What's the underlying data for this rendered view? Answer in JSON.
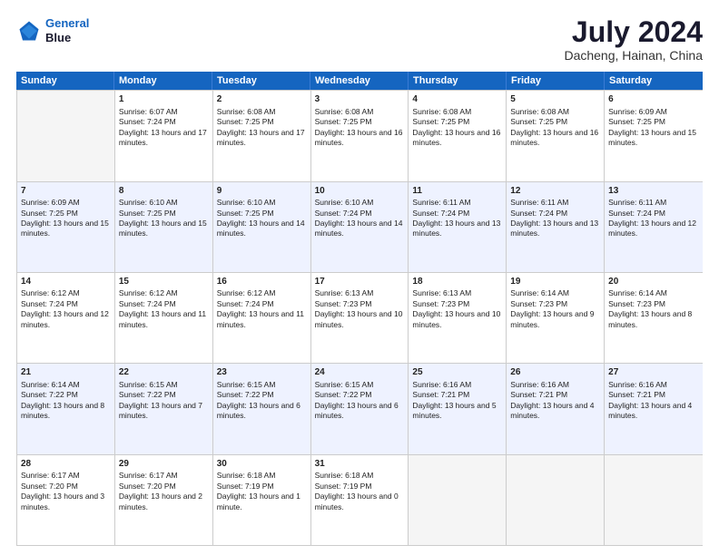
{
  "logo": {
    "line1": "General",
    "line2": "Blue"
  },
  "title": "July 2024",
  "subtitle": "Dacheng, Hainan, China",
  "header_days": [
    "Sunday",
    "Monday",
    "Tuesday",
    "Wednesday",
    "Thursday",
    "Friday",
    "Saturday"
  ],
  "weeks": [
    [
      {
        "day": "",
        "sunrise": "",
        "sunset": "",
        "daylight": "",
        "empty": true
      },
      {
        "day": "1",
        "sunrise": "Sunrise: 6:07 AM",
        "sunset": "Sunset: 7:24 PM",
        "daylight": "Daylight: 13 hours and 17 minutes."
      },
      {
        "day": "2",
        "sunrise": "Sunrise: 6:08 AM",
        "sunset": "Sunset: 7:25 PM",
        "daylight": "Daylight: 13 hours and 17 minutes."
      },
      {
        "day": "3",
        "sunrise": "Sunrise: 6:08 AM",
        "sunset": "Sunset: 7:25 PM",
        "daylight": "Daylight: 13 hours and 16 minutes."
      },
      {
        "day": "4",
        "sunrise": "Sunrise: 6:08 AM",
        "sunset": "Sunset: 7:25 PM",
        "daylight": "Daylight: 13 hours and 16 minutes."
      },
      {
        "day": "5",
        "sunrise": "Sunrise: 6:08 AM",
        "sunset": "Sunset: 7:25 PM",
        "daylight": "Daylight: 13 hours and 16 minutes."
      },
      {
        "day": "6",
        "sunrise": "Sunrise: 6:09 AM",
        "sunset": "Sunset: 7:25 PM",
        "daylight": "Daylight: 13 hours and 15 minutes."
      }
    ],
    [
      {
        "day": "7",
        "sunrise": "Sunrise: 6:09 AM",
        "sunset": "Sunset: 7:25 PM",
        "daylight": "Daylight: 13 hours and 15 minutes."
      },
      {
        "day": "8",
        "sunrise": "Sunrise: 6:10 AM",
        "sunset": "Sunset: 7:25 PM",
        "daylight": "Daylight: 13 hours and 15 minutes."
      },
      {
        "day": "9",
        "sunrise": "Sunrise: 6:10 AM",
        "sunset": "Sunset: 7:25 PM",
        "daylight": "Daylight: 13 hours and 14 minutes."
      },
      {
        "day": "10",
        "sunrise": "Sunrise: 6:10 AM",
        "sunset": "Sunset: 7:24 PM",
        "daylight": "Daylight: 13 hours and 14 minutes."
      },
      {
        "day": "11",
        "sunrise": "Sunrise: 6:11 AM",
        "sunset": "Sunset: 7:24 PM",
        "daylight": "Daylight: 13 hours and 13 minutes."
      },
      {
        "day": "12",
        "sunrise": "Sunrise: 6:11 AM",
        "sunset": "Sunset: 7:24 PM",
        "daylight": "Daylight: 13 hours and 13 minutes."
      },
      {
        "day": "13",
        "sunrise": "Sunrise: 6:11 AM",
        "sunset": "Sunset: 7:24 PM",
        "daylight": "Daylight: 13 hours and 12 minutes."
      }
    ],
    [
      {
        "day": "14",
        "sunrise": "Sunrise: 6:12 AM",
        "sunset": "Sunset: 7:24 PM",
        "daylight": "Daylight: 13 hours and 12 minutes."
      },
      {
        "day": "15",
        "sunrise": "Sunrise: 6:12 AM",
        "sunset": "Sunset: 7:24 PM",
        "daylight": "Daylight: 13 hours and 11 minutes."
      },
      {
        "day": "16",
        "sunrise": "Sunrise: 6:12 AM",
        "sunset": "Sunset: 7:24 PM",
        "daylight": "Daylight: 13 hours and 11 minutes."
      },
      {
        "day": "17",
        "sunrise": "Sunrise: 6:13 AM",
        "sunset": "Sunset: 7:23 PM",
        "daylight": "Daylight: 13 hours and 10 minutes."
      },
      {
        "day": "18",
        "sunrise": "Sunrise: 6:13 AM",
        "sunset": "Sunset: 7:23 PM",
        "daylight": "Daylight: 13 hours and 10 minutes."
      },
      {
        "day": "19",
        "sunrise": "Sunrise: 6:14 AM",
        "sunset": "Sunset: 7:23 PM",
        "daylight": "Daylight: 13 hours and 9 minutes."
      },
      {
        "day": "20",
        "sunrise": "Sunrise: 6:14 AM",
        "sunset": "Sunset: 7:23 PM",
        "daylight": "Daylight: 13 hours and 8 minutes."
      }
    ],
    [
      {
        "day": "21",
        "sunrise": "Sunrise: 6:14 AM",
        "sunset": "Sunset: 7:22 PM",
        "daylight": "Daylight: 13 hours and 8 minutes."
      },
      {
        "day": "22",
        "sunrise": "Sunrise: 6:15 AM",
        "sunset": "Sunset: 7:22 PM",
        "daylight": "Daylight: 13 hours and 7 minutes."
      },
      {
        "day": "23",
        "sunrise": "Sunrise: 6:15 AM",
        "sunset": "Sunset: 7:22 PM",
        "daylight": "Daylight: 13 hours and 6 minutes."
      },
      {
        "day": "24",
        "sunrise": "Sunrise: 6:15 AM",
        "sunset": "Sunset: 7:22 PM",
        "daylight": "Daylight: 13 hours and 6 minutes."
      },
      {
        "day": "25",
        "sunrise": "Sunrise: 6:16 AM",
        "sunset": "Sunset: 7:21 PM",
        "daylight": "Daylight: 13 hours and 5 minutes."
      },
      {
        "day": "26",
        "sunrise": "Sunrise: 6:16 AM",
        "sunset": "Sunset: 7:21 PM",
        "daylight": "Daylight: 13 hours and 4 minutes."
      },
      {
        "day": "27",
        "sunrise": "Sunrise: 6:16 AM",
        "sunset": "Sunset: 7:21 PM",
        "daylight": "Daylight: 13 hours and 4 minutes."
      }
    ],
    [
      {
        "day": "28",
        "sunrise": "Sunrise: 6:17 AM",
        "sunset": "Sunset: 7:20 PM",
        "daylight": "Daylight: 13 hours and 3 minutes."
      },
      {
        "day": "29",
        "sunrise": "Sunrise: 6:17 AM",
        "sunset": "Sunset: 7:20 PM",
        "daylight": "Daylight: 13 hours and 2 minutes."
      },
      {
        "day": "30",
        "sunrise": "Sunrise: 6:18 AM",
        "sunset": "Sunset: 7:19 PM",
        "daylight": "Daylight: 13 hours and 1 minute."
      },
      {
        "day": "31",
        "sunrise": "Sunrise: 6:18 AM",
        "sunset": "Sunset: 7:19 PM",
        "daylight": "Daylight: 13 hours and 0 minutes."
      },
      {
        "day": "",
        "sunrise": "",
        "sunset": "",
        "daylight": "",
        "empty": true
      },
      {
        "day": "",
        "sunrise": "",
        "sunset": "",
        "daylight": "",
        "empty": true
      },
      {
        "day": "",
        "sunrise": "",
        "sunset": "",
        "daylight": "",
        "empty": true
      }
    ]
  ]
}
